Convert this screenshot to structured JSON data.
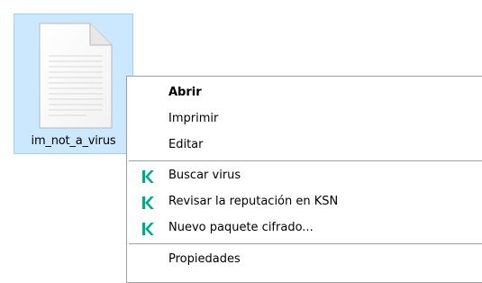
{
  "desktop": {
    "file": {
      "name": "im_not_a_virus",
      "icon": "text-document-icon",
      "selection_color": "#cce8ff"
    }
  },
  "context_menu": {
    "items": [
      {
        "label": "Abrir",
        "bold": true
      },
      {
        "label": "Imprimir"
      },
      {
        "label": "Editar"
      },
      {
        "label": "Buscar virus",
        "icon": "kaspersky-icon"
      },
      {
        "label": "Revisar la reputación en KSN",
        "icon": "kaspersky-icon"
      },
      {
        "label": "Nuevo paquete cifrado...",
        "icon": "kaspersky-icon"
      },
      {
        "label": "Propiedades"
      }
    ],
    "accent_color": "#00a88e"
  }
}
